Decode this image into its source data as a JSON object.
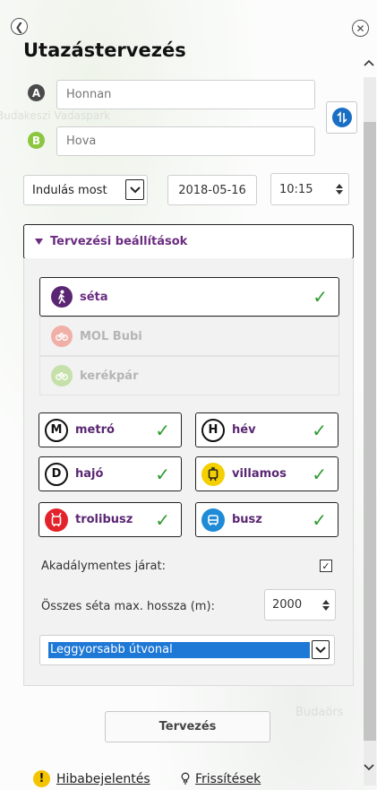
{
  "title": "Utazástervezés",
  "map": {
    "label_top": "Budakeszi Vadaspark",
    "label_bottom": "Budaörs"
  },
  "from": {
    "marker": "A",
    "placeholder": "Honnan"
  },
  "to": {
    "marker": "B",
    "placeholder": "Hova"
  },
  "departure": {
    "mode": "Indulás most",
    "date": "2018-05-16",
    "time": "10:15"
  },
  "settings": {
    "header": "Tervezési beállítások",
    "walk_modes": [
      {
        "label": "séta",
        "enabled": true
      },
      {
        "label": "MOL Bubi",
        "enabled": false
      },
      {
        "label": "kerékpár",
        "enabled": false
      }
    ],
    "transit_modes": [
      {
        "label": "metró",
        "icon": "metro-icon",
        "checked": true
      },
      {
        "label": "hév",
        "icon": "hev-icon",
        "checked": true
      },
      {
        "label": "hajó",
        "icon": "ship-icon",
        "checked": true
      },
      {
        "label": "villamos",
        "icon": "tram-icon",
        "checked": true
      },
      {
        "label": "trolibusz",
        "icon": "trolleybus-icon",
        "checked": true
      },
      {
        "label": "busz",
        "icon": "bus-icon",
        "checked": true
      }
    ],
    "accessible_label": "Akadálymentes járat:",
    "accessible_checked": true,
    "walk_max_label": "Összes séta max. hossza (m):",
    "walk_max_value": "2000",
    "route_option": "Leggyorsabb útvonal"
  },
  "plan_button": "Tervezés",
  "footer": {
    "report": "Hibabejelentés",
    "updates": "Frissítések"
  },
  "colors": {
    "accent_purple": "#6b2d82",
    "check_green": "#2e9a2e",
    "swap_blue": "#1a6fc4"
  }
}
